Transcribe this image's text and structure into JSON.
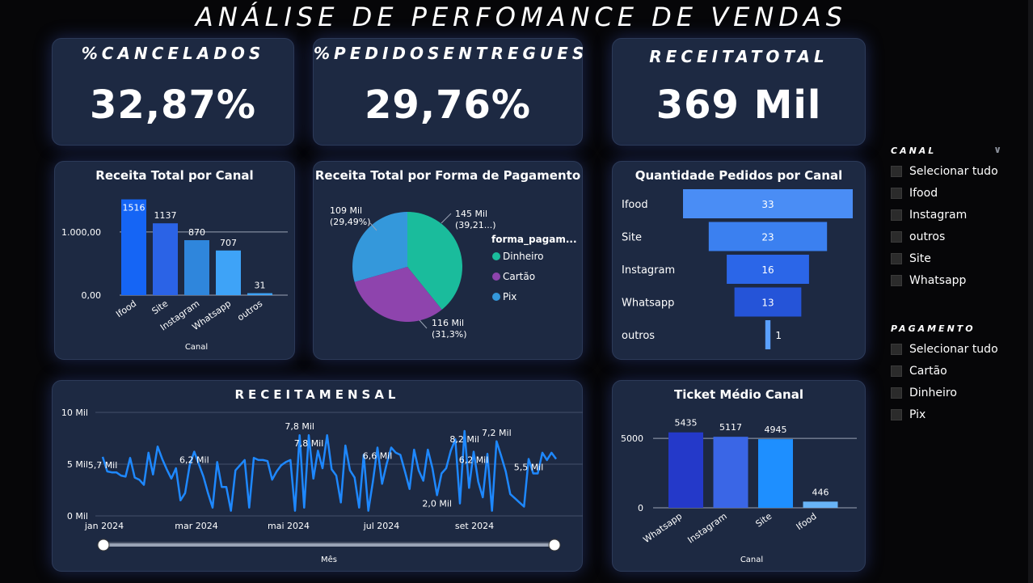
{
  "title": "ANÁLISE DE PERFOMANCE  DE  VENDAS",
  "kpis": {
    "cancelados": {
      "label": "%CANCELADOS",
      "value": "32,87%"
    },
    "entregues": {
      "label": "%PEDIDOSENTREGUES",
      "value": "29,76%"
    },
    "receita": {
      "label": "RECEITATOTAL",
      "value": "369 Mil"
    }
  },
  "canal_chart": {
    "title": "Receita Total por Canal",
    "y_ticks": [
      "1.000,00",
      "0,00"
    ],
    "xlabel": "Canal",
    "categories": [
      "Ifood",
      "Site",
      "Instagram",
      "Whatsapp",
      "outros"
    ],
    "values": [
      1516,
      1137,
      870,
      707,
      31
    ],
    "labels": [
      "1516",
      "1137",
      "870",
      "707",
      "31"
    ],
    "colors": [
      "#1565f5",
      "#2b63e6",
      "#2f86dc",
      "#3ea3f7",
      "#3ea3f7"
    ]
  },
  "pagamento_chart": {
    "title": "Receita Total por Forma de Pagamento",
    "legend_title": "forma_pagam...",
    "slices": [
      {
        "name": "Dinheiro",
        "value": 145,
        "color": "#1abc9c",
        "label_1": "145 Mil",
        "label_2": "(39,21...)"
      },
      {
        "name": "Cartão",
        "value": 116,
        "color": "#8e44ad",
        "label_1": "116 Mil",
        "label_2": "(31,3%)"
      },
      {
        "name": "Pix",
        "value": 109,
        "color": "#3498db",
        "label_1": "109 Mil",
        "label_2": "(29,49%)"
      }
    ]
  },
  "funnel_chart": {
    "title": "Quantidade Pedidos por Canal",
    "items": [
      {
        "label": "Ifood",
        "value": 33,
        "text": "33",
        "color": "#4a8df5"
      },
      {
        "label": "Site",
        "value": 23,
        "text": "23",
        "color": "#3b80f0"
      },
      {
        "label": "Instagram",
        "value": 16,
        "text": "16",
        "color": "#2b66e8"
      },
      {
        "label": "Whatsapp",
        "value": 13,
        "text": "13",
        "color": "#2554d8"
      },
      {
        "label": "outros",
        "value": 1,
        "text": "1",
        "color": "#5aa0ff"
      }
    ]
  },
  "mensal_chart": {
    "title": "RECEITAMENSAL",
    "y_ticks": [
      "10 Mil",
      "5 Mil",
      "0 Mil"
    ],
    "x_ticks": [
      "jan 2024",
      "mar 2024",
      "mai 2024",
      "jul 2024",
      "set 2024"
    ],
    "xlabel": "Mês",
    "line_color": "#1e88ff",
    "values": [
      5.7,
      4.3,
      4.2,
      4.2,
      3.9,
      3.8,
      5.6,
      3.7,
      3.5,
      3.0,
      6.1,
      4.0,
      6.7,
      5.5,
      4.5,
      3.6,
      4.6,
      1.5,
      2.2,
      4.9,
      6.2,
      5.0,
      3.8,
      2.2,
      0.8,
      5.2,
      2.8,
      2.8,
      0.5,
      4.4,
      4.9,
      5.4,
      0.8,
      5.6,
      5.4,
      5.4,
      5.3,
      3.5,
      4.3,
      4.9,
      5.2,
      5.4,
      0.5,
      7.8,
      0.8,
      7.8,
      3.6,
      6.3,
      4.6,
      7.8,
      4.5,
      3.9,
      1.3,
      6.8,
      4.4,
      3.7,
      0.8,
      5.9,
      0.5,
      3.3,
      6.6,
      3.1,
      5.0,
      6.6,
      6.1,
      5.9,
      4.3,
      2.6,
      6.4,
      4.4,
      3.4,
      6.4,
      4.6,
      2.0,
      4.1,
      4.6,
      6.3,
      7.4,
      1.2,
      8.2,
      2.7,
      6.2,
      3.3,
      1.8,
      6.0,
      0.5,
      7.2,
      5.8,
      4.3,
      2.1,
      1.7,
      1.3,
      0.9,
      5.5,
      4.1,
      4.1,
      6.1,
      5.4,
      6.1,
      5.5
    ],
    "labels": [
      {
        "text": "5,7 Mil",
        "idx": 0,
        "pos": "below"
      },
      {
        "text": "6,2 Mil",
        "idx": 20,
        "pos": "below"
      },
      {
        "text": "7,8 Mil",
        "idx": 43,
        "pos": "above"
      },
      {
        "text": "7,8 Mil",
        "idx": 45,
        "pos": "below"
      },
      {
        "text": "6,6 Mil",
        "idx": 60,
        "pos": "below"
      },
      {
        "text": "2,0 Mil",
        "idx": 73,
        "pos": "below"
      },
      {
        "text": "8,2 Mil",
        "idx": 79,
        "pos": "below"
      },
      {
        "text": "6,2 Mil",
        "idx": 81,
        "pos": "below"
      },
      {
        "text": "7,2 Mil",
        "idx": 86,
        "pos": "above"
      },
      {
        "text": "5,5 Mil",
        "idx": 93,
        "pos": "below"
      }
    ]
  },
  "ticket_chart": {
    "title": "Ticket Médio Canal",
    "y_ticks": [
      "5000",
      "0"
    ],
    "xlabel": "Canal",
    "categories": [
      "Whatsapp",
      "Instagram",
      "Site",
      "Ifood"
    ],
    "values": [
      5435,
      5117,
      4945,
      446
    ],
    "labels": [
      "5435",
      "5117",
      "4945",
      "446"
    ],
    "colors": [
      "#2439c9",
      "#3a66e6",
      "#1e8fff",
      "#69b4f7"
    ]
  },
  "slicer_canal": {
    "title": "CANAL",
    "items": [
      "Selecionar tudo",
      "Ifood",
      "Instagram",
      "outros",
      "Site",
      "Whatsapp"
    ]
  },
  "slicer_pagamento": {
    "title": "PAGAMENTO",
    "items": [
      "Selecionar tudo",
      "Cartão",
      "Dinheiro",
      "Pix"
    ]
  },
  "chart_data": [
    {
      "type": "bar",
      "title": "Receita Total por Canal",
      "categories": [
        "Ifood",
        "Site",
        "Instagram",
        "Whatsapp",
        "outros"
      ],
      "values": [
        1516,
        1137,
        870,
        707,
        31
      ],
      "xlabel": "Canal",
      "ylim": [
        0,
        1600
      ]
    },
    {
      "type": "pie",
      "title": "Receita Total por Forma de Pagamento",
      "categories": [
        "Dinheiro",
        "Cartão",
        "Pix"
      ],
      "values": [
        145,
        116,
        109
      ]
    },
    {
      "type": "bar",
      "title": "Quantidade Pedidos por Canal",
      "categories": [
        "Ifood",
        "Site",
        "Instagram",
        "Whatsapp",
        "outros"
      ],
      "values": [
        33,
        23,
        16,
        13,
        1
      ]
    },
    {
      "type": "line",
      "title": "RECEITAMENSAL",
      "xlabel": "Mês",
      "ylim": [
        0,
        10
      ]
    },
    {
      "type": "bar",
      "title": "Ticket Médio Canal",
      "categories": [
        "Whatsapp",
        "Instagram",
        "Site",
        "Ifood"
      ],
      "values": [
        5435,
        5117,
        4945,
        446
      ],
      "xlabel": "Canal"
    }
  ]
}
